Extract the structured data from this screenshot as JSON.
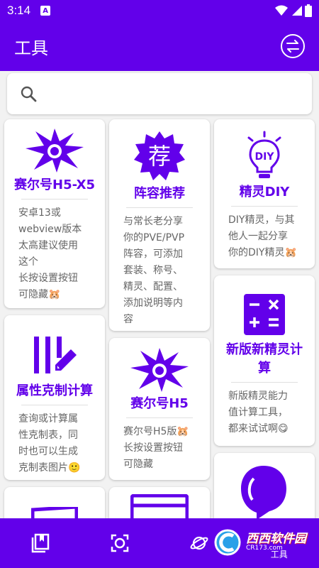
{
  "status_bar": {
    "time": "3:14",
    "notification_icon": "A"
  },
  "app_bar": {
    "title": "工具"
  },
  "search": {
    "placeholder": "",
    "value": ""
  },
  "cards": [
    {
      "title": "赛尔号H5-X5",
      "desc": "安卓13或\nwebview版本\n太高建议使用\n这个\n长按设置按钮\n可隐藏🐹"
    },
    {
      "title": "阵容推荐",
      "desc": "与常长老分享\n你的PVE/PVP\n阵容，可添加\n套装、称号、\n精灵、配置、\n添加说明等内\n容",
      "icon_text": "荐"
    },
    {
      "title": "精灵DIY",
      "desc": "DIY精灵，与其\n他人一起分享\n你的DIY精灵🐹",
      "icon_text": "DIY"
    },
    {
      "title": "属性克制计算",
      "desc": "查询或计算属\n性克制表，同\n时也可以生成\n克制表图片🙂"
    },
    {
      "title": "赛尔号H5",
      "desc": "赛尔号H5版🐹\n长按设置按钮\n可隐藏"
    },
    {
      "title": "新版新精灵计\n算",
      "desc": "新版精灵能力\n值计算工具，\n都来试试啊😋"
    }
  ],
  "bottom_nav": {
    "partial_label": "工具"
  },
  "watermark": {
    "text": "西西软件园",
    "sub": "CR173.com"
  },
  "colors": {
    "primary": "#6200ea",
    "background": "#f2f2f2",
    "card": "#ffffff",
    "text_secondary": "#666666"
  }
}
